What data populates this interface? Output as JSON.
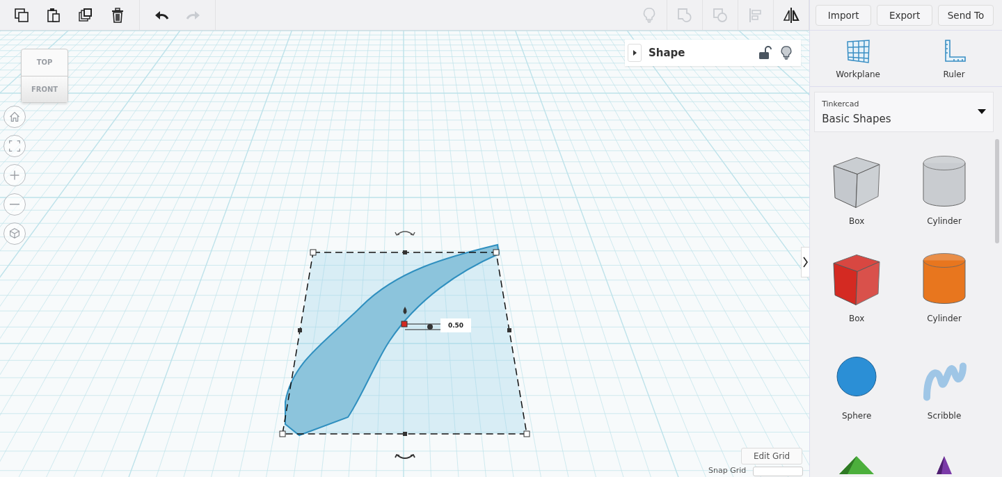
{
  "toolbar": {
    "tools": [
      {
        "kind": "copy",
        "disabled": false
      },
      {
        "kind": "paste",
        "disabled": false
      },
      {
        "kind": "duplicate",
        "disabled": false
      },
      {
        "kind": "delete",
        "disabled": false
      },
      {
        "kind": "undo",
        "disabled": false
      },
      {
        "kind": "redo",
        "disabled": true
      }
    ],
    "view_tools": [
      {
        "kind": "bulb",
        "disabled": true
      },
      {
        "kind": "group",
        "disabled": true
      },
      {
        "kind": "ungroup",
        "disabled": true
      },
      {
        "kind": "align",
        "disabled": true
      },
      {
        "kind": "mirror",
        "disabled": false
      }
    ],
    "buttons": [
      "Import",
      "Export",
      "Send To"
    ]
  },
  "view_cube": {
    "top": "TOP",
    "front": "FRONT"
  },
  "nav_buttons": [
    {
      "kind": "home"
    },
    {
      "kind": "fit"
    },
    {
      "kind": "zoom-in"
    },
    {
      "kind": "zoom-out"
    },
    {
      "kind": "perspective"
    }
  ],
  "inspector": {
    "title": "Shape",
    "expanded": false,
    "locked": false
  },
  "selection": {
    "value": "0.50"
  },
  "grid_controls": {
    "edit_button": "Edit Grid",
    "snap_label": "Snap Grid"
  },
  "panel": {
    "tools": [
      {
        "kind": "workplane",
        "label": "Workplane"
      },
      {
        "kind": "ruler",
        "label": "Ruler"
      }
    ],
    "library": {
      "source": "Tinkercad",
      "category": "Basic Shapes"
    },
    "shapes": [
      {
        "kind": "box",
        "label": "Box",
        "color": "#c4c8cd"
      },
      {
        "kind": "cylinder",
        "label": "Cylinder",
        "color": "#c9ccd0"
      },
      {
        "kind": "box",
        "label": "Box",
        "color": "#d42a22"
      },
      {
        "kind": "cylinder",
        "label": "Cylinder",
        "color": "#e8761e"
      },
      {
        "kind": "sphere",
        "label": "Sphere",
        "color": "#2b8fd6"
      },
      {
        "kind": "scribble",
        "label": "Scribble",
        "color": "#9fc6e6"
      },
      {
        "kind": "roof",
        "color": "#4caf3c"
      },
      {
        "kind": "cone",
        "color": "#7b3aa8"
      }
    ]
  }
}
